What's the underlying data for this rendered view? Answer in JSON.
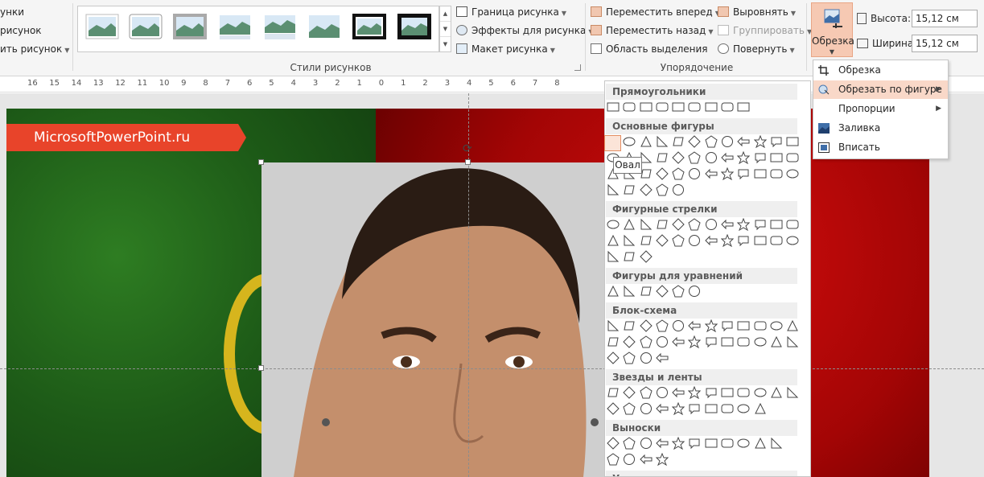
{
  "ribbon": {
    "left_group": {
      "items": [
        "унки",
        "рисунок",
        "ить рисунок"
      ]
    },
    "styles_group": {
      "label": "Стили рисунков",
      "border_btn": "Граница рисунка",
      "effects_btn": "Эффекты для рисунка",
      "layout_btn": "Макет рисунка"
    },
    "arrange_group": {
      "label": "Упорядочение",
      "forward_btn": "Переместить вперед",
      "backward_btn": "Переместить назад",
      "selection_btn": "Область выделения",
      "align_btn": "Выровнять",
      "group_btn": "Группировать",
      "rotate_btn": "Повернуть"
    },
    "size_group": {
      "crop_btn": "Обрезка",
      "height_label": "Высота:",
      "height_value": "15,12 см",
      "width_label": "Ширина:",
      "width_value": "15,12 см"
    }
  },
  "ruler": {
    "numbers": [
      "16",
      "15",
      "14",
      "13",
      "12",
      "11",
      "10",
      "9",
      "8",
      "7",
      "6",
      "5",
      "4",
      "3",
      "2",
      "1",
      "0",
      "1",
      "2",
      "3",
      "4",
      "5",
      "6",
      "7",
      "8"
    ]
  },
  "slide": {
    "banner_text": "MicrosoftPowerPoint.ru"
  },
  "crop_menu": {
    "items": [
      {
        "label": "Обрезка",
        "icon": "crop-icon"
      },
      {
        "label": "Обрезать по фигуре",
        "icon": "shape-crop-icon",
        "submenu": true,
        "highlighted": true
      },
      {
        "label": "Пропорции",
        "icon": "",
        "submenu": true
      },
      {
        "label": "Заливка",
        "icon": "fill-icon"
      },
      {
        "label": "Вписать",
        "icon": "fit-icon"
      }
    ]
  },
  "shapes_panel": {
    "categories": [
      "Прямоугольники",
      "Основные фигуры",
      "Фигурные стрелки",
      "Фигуры для уравнений",
      "Блок-схема",
      "Звезды и ленты",
      "Выноски",
      "Управляющие кнопки"
    ],
    "tooltip": "Овал"
  },
  "colors": {
    "accent": "#f6c9b3",
    "banner": "#e8442a",
    "flag_green": "#1d5a17",
    "flag_red": "#a30505"
  }
}
